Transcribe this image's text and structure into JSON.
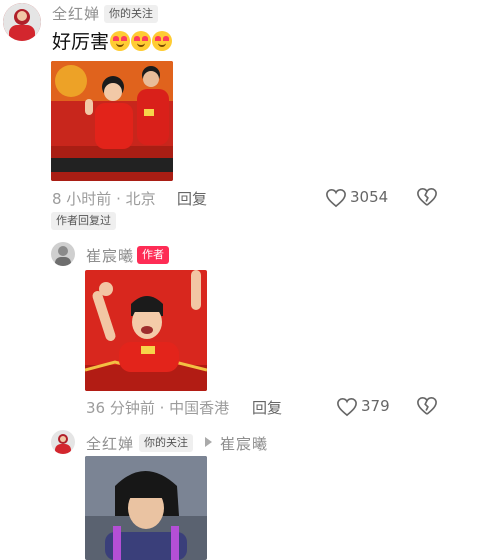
{
  "comment1": {
    "username": "全红婵",
    "follow_tag": "你的关注",
    "text": "好厉害",
    "emoji_name": "heart-eyes-emoji",
    "time": "8 小时前 · 北京",
    "reply_label": "回复",
    "like_count": "3054",
    "author_replied_badge": "作者回复过"
  },
  "reply1": {
    "username": "崔宸曦",
    "author_tag": "作者",
    "time": "36 分钟前 · 中国香港",
    "reply_label": "回复",
    "like_count": "379"
  },
  "reply2": {
    "username": "全红婵",
    "follow_tag": "你的关注",
    "reply_to": "崔宸曦"
  },
  "colors": {
    "author_tag_bg": "#fe2c55",
    "image_red": "#d8271e"
  }
}
